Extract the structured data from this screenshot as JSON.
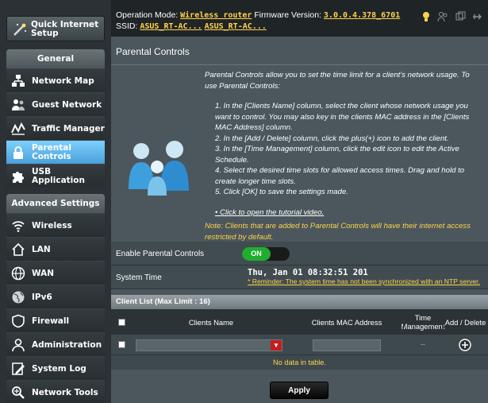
{
  "sidebar": {
    "quick_setup": "Quick Internet\nSetup",
    "general_title": "General",
    "general_items": [
      {
        "label": "Network Map",
        "icon": "network-map-icon"
      },
      {
        "label": "Guest Network",
        "icon": "guest-network-icon"
      },
      {
        "label": "Traffic Manager",
        "icon": "traffic-manager-icon"
      },
      {
        "label": "Parental\nControls",
        "icon": "parental-controls-icon",
        "active": true
      },
      {
        "label": "USB Application",
        "icon": "puzzle-icon"
      }
    ],
    "advanced_title": "Advanced Settings",
    "advanced_items": [
      {
        "label": "Wireless",
        "icon": "wifi-icon"
      },
      {
        "label": "LAN",
        "icon": "home-icon"
      },
      {
        "label": "WAN",
        "icon": "globe-icon"
      },
      {
        "label": "IPv6",
        "icon": "ipv6-globe-icon"
      },
      {
        "label": "Firewall",
        "icon": "shield-icon"
      },
      {
        "label": "Administration",
        "icon": "admin-user-icon"
      },
      {
        "label": "System Log",
        "icon": "log-icon"
      },
      {
        "label": "Network Tools",
        "icon": "network-tools-icon"
      }
    ]
  },
  "topbar": {
    "opmode_label": "Operation Mode:",
    "opmode_value": "Wireless router",
    "firmware_label": "Firmware Version:",
    "firmware_value": "3.0.0.4.378_6701",
    "ssid_label": "SSID:",
    "ssid_1": "ASUS_RT-AC...",
    "ssid_2": "ASUS_RT-AC..."
  },
  "main": {
    "title": "Parental Controls",
    "intro": "Parental Controls allow you to set the time limit for a client's network usage. To use Parental Controls:",
    "steps": [
      "1. In the [Clients Name] column, select the client whose network usage you want to control. You may also key in the clients MAC address in the [Clients MAC Address] column.",
      "2. In the [Add / Delete] column, click the plus(+) icon to add the client.",
      "3. In the [Time Management] column, click the edit icon to edit the Active Schedule.",
      "4. Select the desired time slots for allowed access times. Drag and hold to create longer time slots.",
      "5. Click [OK] to save the settings made."
    ],
    "tutorial_link": "Click to open the tutorial video.",
    "note": "Note: Clients that are added to Parental Controls will have their internet access restricted by default.",
    "enable_label": "Enable Parental Controls",
    "toggle_on": "ON",
    "systime_label": "System Time",
    "systime_value": "Thu, Jan 01 08:32:51 201",
    "systime_reminder": "* Reminder: The system time has not been synchronized with an NTP server.",
    "client_list_title": "Client List (Max Limit : 16)",
    "col_name": "Clients Name",
    "col_mac": "Clients MAC Address",
    "col_time": "Time\nManagement",
    "col_add": "Add / Delete",
    "time_dash": "--",
    "no_data": "No data in table.",
    "apply": "Apply"
  },
  "colors": {
    "accent_yellow": "#ffd24d",
    "active_menu": "#5bb5ec",
    "toggle_green": "#1fad2f"
  }
}
